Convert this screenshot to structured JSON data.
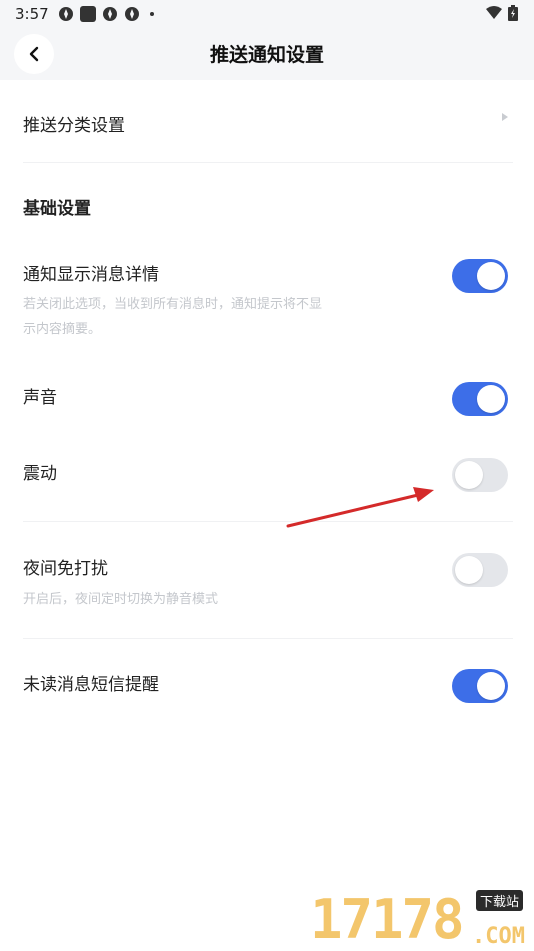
{
  "status_bar": {
    "time": "3:57"
  },
  "header": {
    "title": "推送通知设置"
  },
  "push_category": {
    "label": "推送分类设置"
  },
  "basic_section": {
    "title": "基础设置"
  },
  "settings": {
    "notify_detail": {
      "label": "通知显示消息详情",
      "desc": "若关闭此选项，当收到所有消息时，通知提示将不显示内容摘要。",
      "on": true
    },
    "sound": {
      "label": "声音",
      "on": true
    },
    "vibrate": {
      "label": "震动",
      "on": false
    },
    "night_dnd": {
      "label": "夜间免打扰",
      "desc": "开启后，夜间定时切换为静音模式",
      "on": false
    },
    "sms_unread": {
      "label": "未读消息短信提醒",
      "on": true
    }
  },
  "colors": {
    "toggle_on": "#3d6ee8",
    "toggle_off": "#e4e6ea",
    "arrow": "#d42a2a"
  },
  "watermark": {
    "number": "17178",
    "tag": "下载站",
    "suffix": ".COM"
  }
}
